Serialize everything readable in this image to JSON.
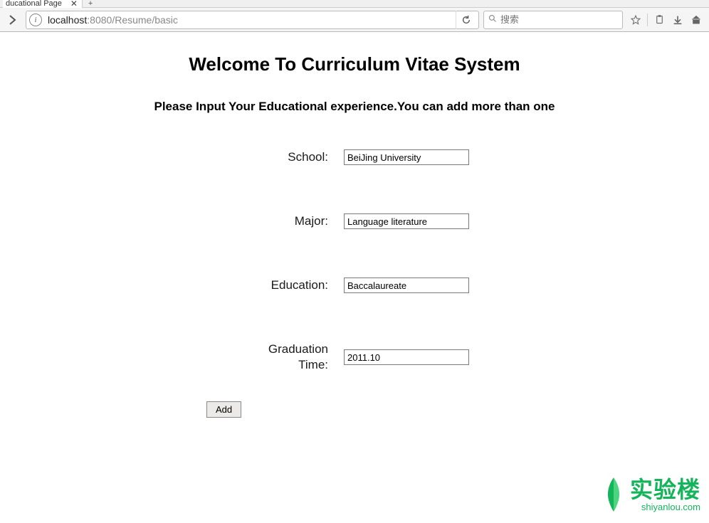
{
  "browser": {
    "tab_title": "ducational Page",
    "url": {
      "host": "localhost",
      "port": ":8080",
      "path": "/Resume/basic"
    },
    "search_placeholder": "搜索"
  },
  "page": {
    "title": "Welcome To Curriculum Vitae System",
    "subtitle": "Please Input Your Educational experience.You can add more than one"
  },
  "form": {
    "school": {
      "label": "School:",
      "value": "BeiJing University"
    },
    "major": {
      "label": "Major:",
      "value": "Language literature"
    },
    "education": {
      "label": "Education:",
      "value": "Baccalaureate"
    },
    "graduation": {
      "label": "Graduation Time:",
      "value": "2011.10"
    },
    "add_button": "Add"
  },
  "watermark": {
    "cn": "实验楼",
    "en": "shiyanlou.com",
    "color": "#14b45a"
  }
}
